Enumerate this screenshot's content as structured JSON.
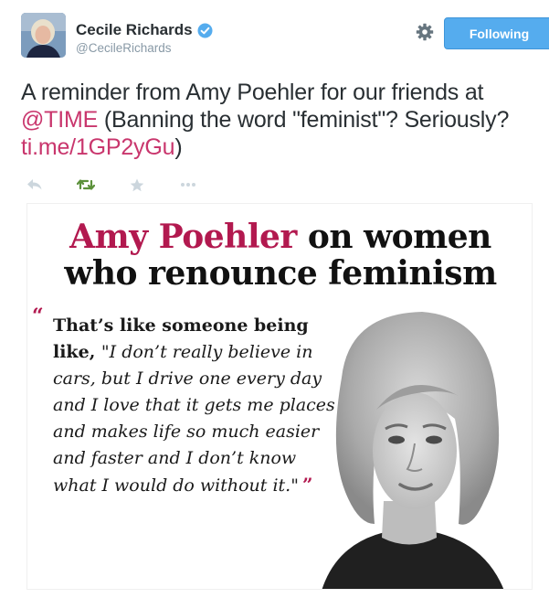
{
  "author": {
    "name": "Cecile Richards",
    "handle": "@CecileRichards"
  },
  "follow_button": {
    "label": "Following"
  },
  "tweet": {
    "text_part1": "A reminder from Amy Poehler for our friends at ",
    "mention": "@TIME",
    "text_part2": " (Banning the word \"feminist\"? Seriously? ",
    "link": "ti.me/1GP2yGu",
    "text_part3": ")"
  },
  "actions": [
    "reply-icon",
    "retweet-icon",
    "favorite-icon",
    "more-icon"
  ],
  "colors": {
    "link": "#c9366d",
    "follow_button": "#55acee",
    "retweet_green": "#5c913b",
    "title_accent": "#b2194f"
  },
  "media": {
    "title_name": "Amy Poehler",
    "title_rest_line1": " on women",
    "title_line2": "who renounce feminism",
    "quote_open_mark": "“",
    "quote_lead": "That’s like someone being like, ",
    "quote_body": "\"I don’t really believe in cars, but I drive one every day and I love that it gets me places and makes life so much easier and faster and I don’t know what I would do without it.\"",
    "quote_close_mark": "”"
  }
}
